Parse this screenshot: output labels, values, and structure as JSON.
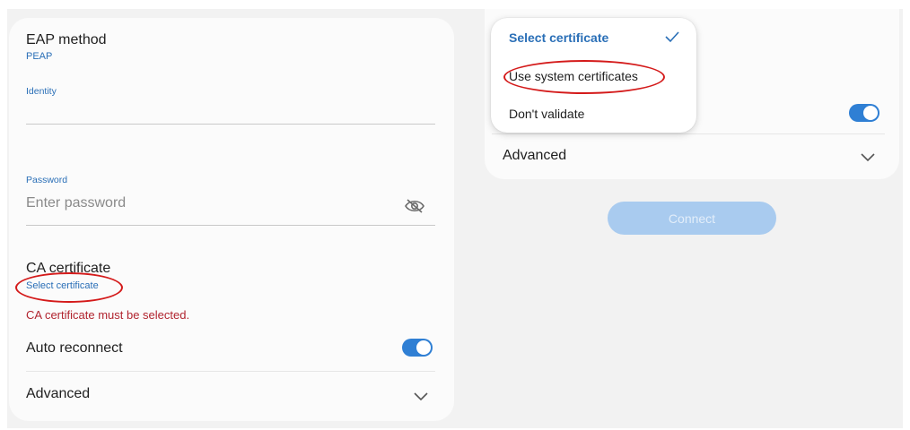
{
  "left_panel": {
    "eap_title": "EAP method",
    "eap_value": "PEAP",
    "identity_label": "Identity",
    "password_label": "Password",
    "password_placeholder": "Enter password",
    "ca_title": "CA certificate",
    "ca_value": "Select certificate",
    "ca_error": "CA certificate must be selected.",
    "auto_reconnect_label": "Auto reconnect",
    "auto_reconnect_on": true,
    "advanced_label": "Advanced"
  },
  "dropdown": {
    "options": [
      "Select certificate",
      "Use system certificates",
      "Don't validate"
    ],
    "selected": "Select certificate"
  },
  "right_panel": {
    "advanced_label": "Advanced",
    "toggle_on": true,
    "connect_label": "Connect"
  },
  "colors": {
    "accent": "#2a6fb7",
    "toggle": "#2f7fd4",
    "error": "#b1242f",
    "annotation": "#d41a1a",
    "connect_disabled": "#a9cbef"
  }
}
